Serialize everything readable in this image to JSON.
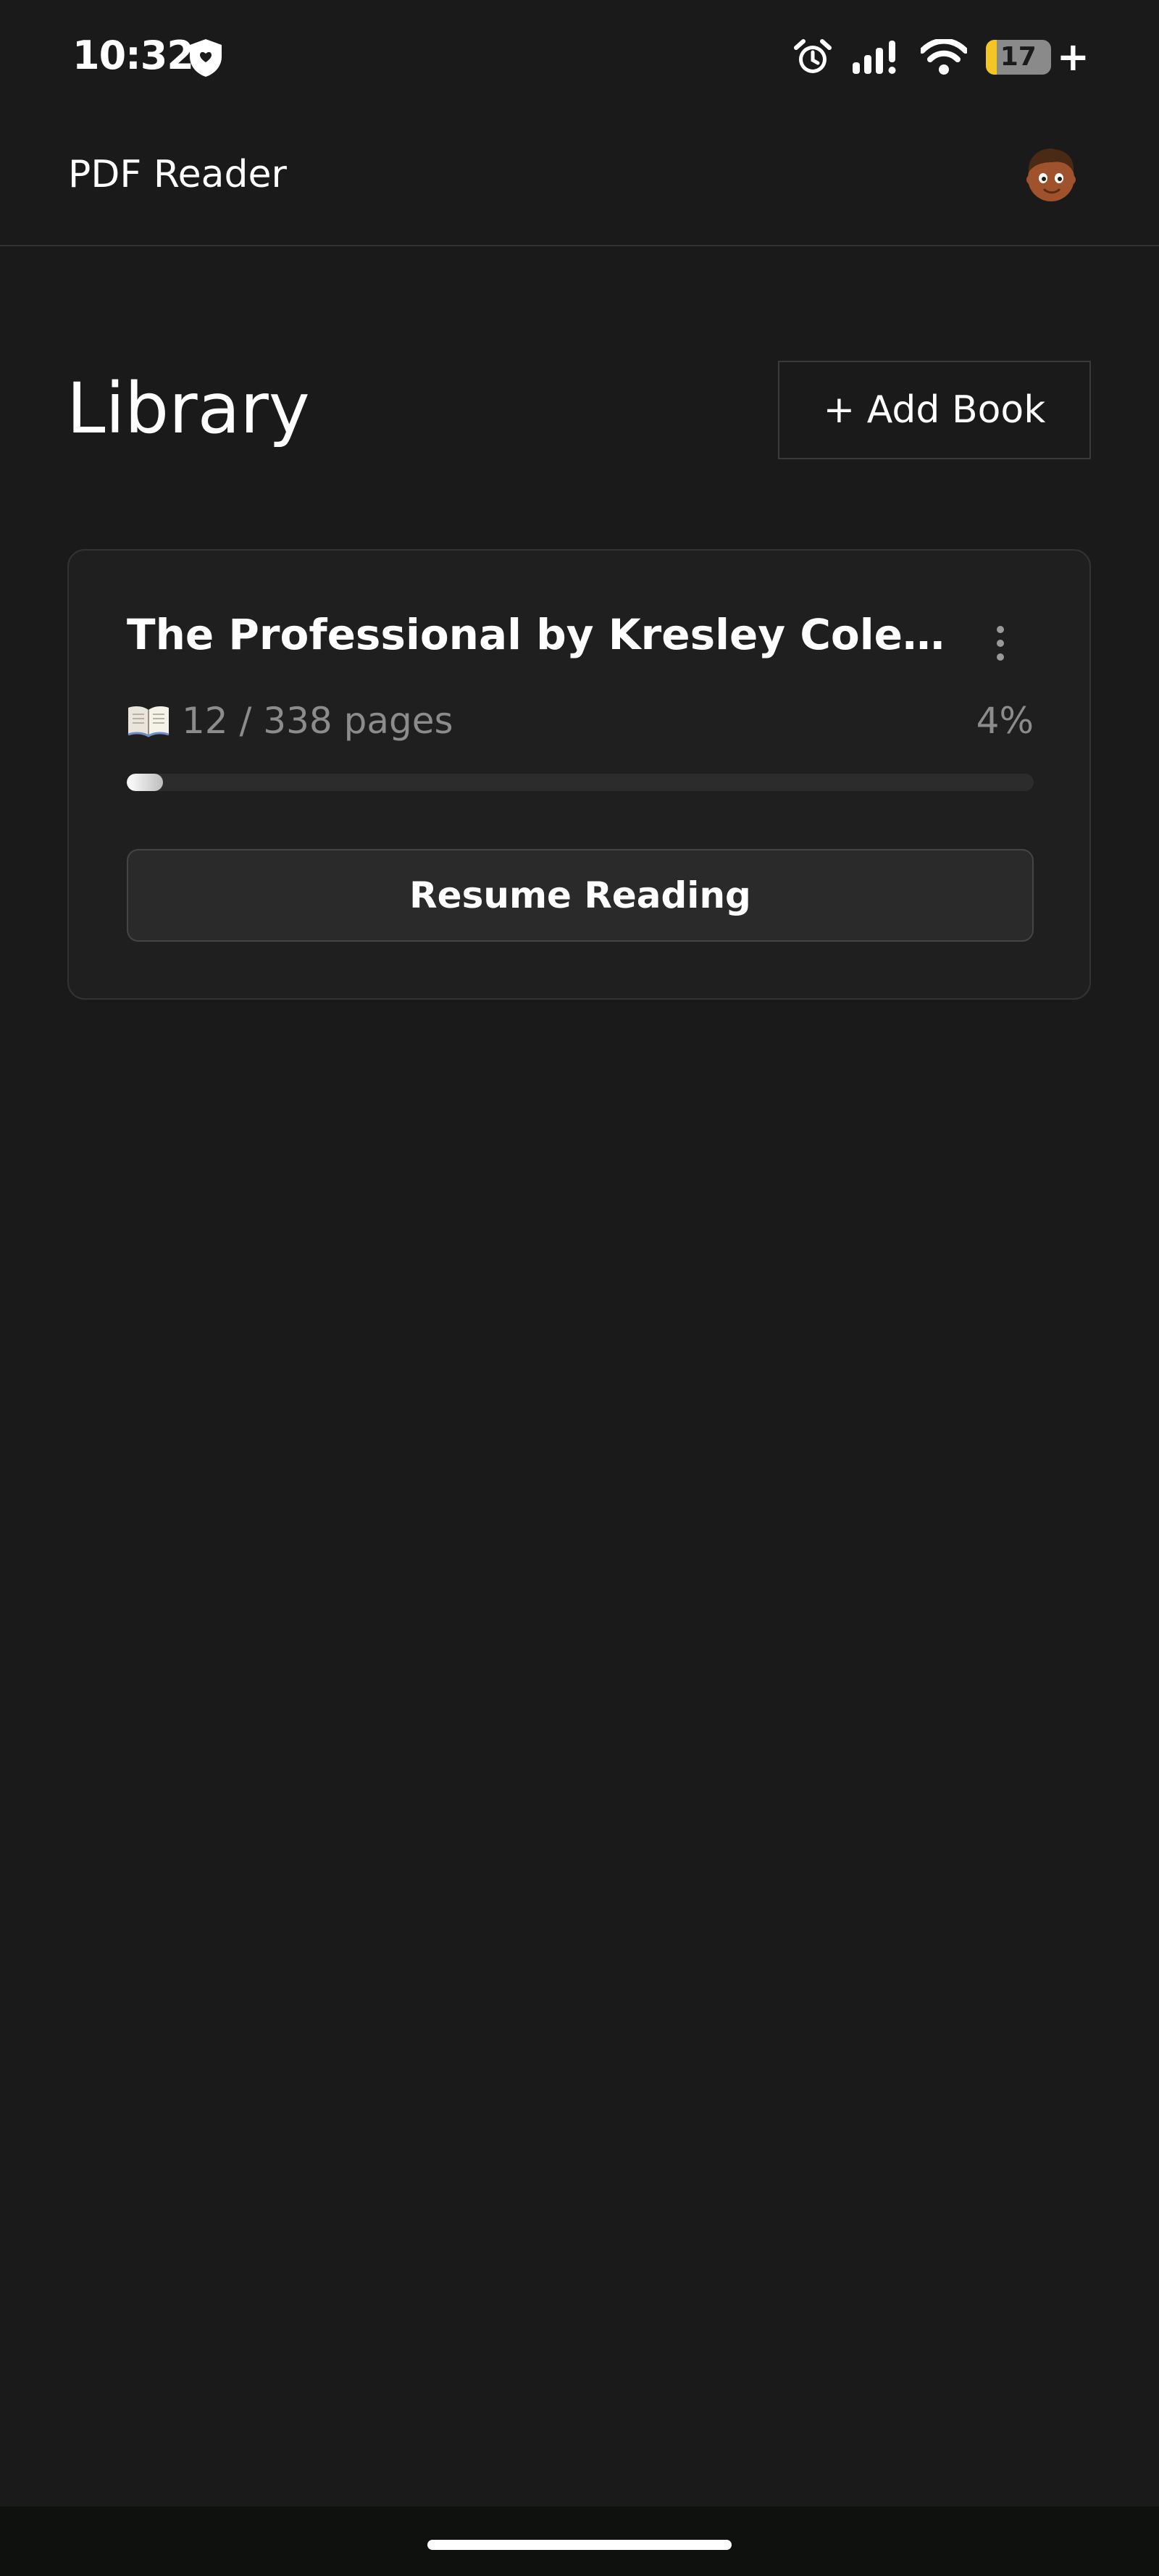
{
  "status_bar": {
    "time": "10:32",
    "battery_level": "17",
    "battery_percent": 17,
    "icons": [
      "shield-icon",
      "alarm-icon",
      "signal-icon",
      "wifi-icon",
      "battery-icon"
    ]
  },
  "app_bar": {
    "title": "PDF Reader"
  },
  "library": {
    "title": "Library",
    "add_book_label": "+ Add Book",
    "books": [
      {
        "title": "The Professional by Kresley Cole Bo...",
        "pages_label": "12 / 338 pages",
        "current_page": 12,
        "total_pages": 338,
        "progress_label": "4%",
        "progress_fraction": 0.04,
        "resume_label": "Resume Reading"
      }
    ]
  },
  "colors": {
    "background": "#1a1a1a",
    "card": "#1f1f1f",
    "battery": "#f3c623"
  }
}
